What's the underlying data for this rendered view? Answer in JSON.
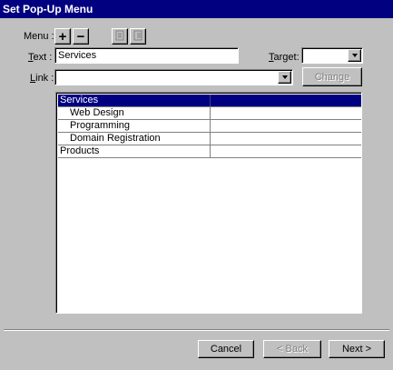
{
  "window": {
    "title": "Set Pop-Up Menu"
  },
  "menu_row": {
    "label": "Menu :",
    "add_glyph": "+",
    "remove_glyph": "−",
    "icons": [
      "plus-icon",
      "minus-icon",
      "outdent-icon",
      "indent-icon"
    ]
  },
  "text_row": {
    "label_prefix": "",
    "label_u": "T",
    "label_rest": "ext :",
    "value": "Services"
  },
  "target_row": {
    "label_u": "T",
    "label_rest": "arget:",
    "value": ""
  },
  "link_row": {
    "label_u": "L",
    "label_rest": "ink :",
    "value": "",
    "change_label": "Change"
  },
  "tree": {
    "items": [
      {
        "label": "Services",
        "indent": 0,
        "selected": true
      },
      {
        "label": "Web Design",
        "indent": 1,
        "selected": false
      },
      {
        "label": "Programming",
        "indent": 1,
        "selected": false
      },
      {
        "label": "Domain Registration",
        "indent": 1,
        "selected": false
      },
      {
        "label": "Products",
        "indent": 0,
        "selected": false
      }
    ]
  },
  "footer": {
    "cancel": "Cancel",
    "back": "< Back",
    "next": "Next >"
  },
  "colors": {
    "selection": "#000080",
    "face": "#c0c0c0"
  }
}
